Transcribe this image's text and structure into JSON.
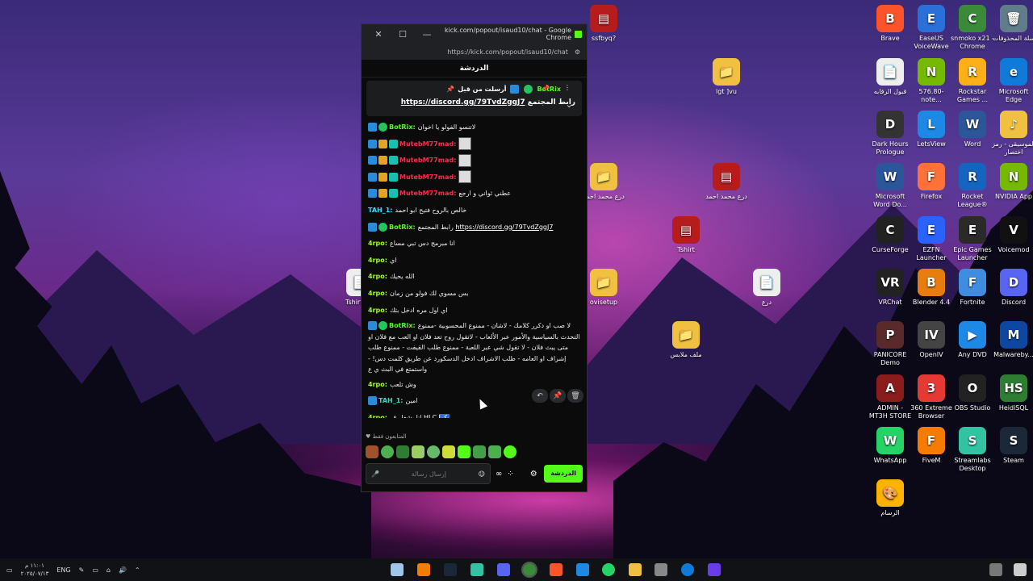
{
  "window": {
    "title": "kick.com/popout/isaud10/chat - Google Chrome",
    "url": "https://kick.com/popout/isaud10/chat",
    "chat_title": "الدردشة"
  },
  "pinned": {
    "pinned_by": "أرسلت من قبل",
    "bot": "BotRix",
    "label": "رابط المجتمع",
    "link": "https://discord.gg/79TvdZggJ7"
  },
  "messages": [
    {
      "user": "BotRix:",
      "color": "green",
      "text": "لاتنسو الفولو يا اخوان"
    },
    {
      "user": "MutebM77mad:",
      "color": "red",
      "text": ""
    },
    {
      "user": "MutebM77mad:",
      "color": "red",
      "text": ""
    },
    {
      "user": "MutebM77mad:",
      "color": "red",
      "text": ""
    },
    {
      "user": "MutebM77mad:",
      "color": "red",
      "text": "عطني ثواني و ارجع"
    },
    {
      "user": "TAH_1:",
      "color": "cyan",
      "text": "خالص بالروح فتيح ابو احمد"
    },
    {
      "user": "BotRix:",
      "color": "green",
      "text": "رابط المجتمع",
      "link": "https://discord.gg/79TvdZggJ7"
    },
    {
      "user": "4rpo:",
      "color": "lime",
      "text": "انا مبرمج دس تبي مساع"
    },
    {
      "user": "4rpo:",
      "color": "lime",
      "text": "اي"
    },
    {
      "user": "4rpo:",
      "color": "lime",
      "text": "الله يحيك"
    },
    {
      "user": "4rpo:",
      "color": "lime",
      "text": "بس مسوي لك فولو من زمان"
    },
    {
      "user": "4rpo:",
      "color": "lime",
      "text": "اي اول مره ادخل بثك"
    },
    {
      "user": "BotRix:",
      "color": "green",
      "text": "لا صب او دكرر كلامك - لاشان - ممنوع المحسوبية -ممنوع التحدث بالسياسية والأمور عبر الألعاب - لاتقول روح تعد فلان او العب مع فلان او متى يبث فلان - لا تقول شي عبر اللعبة - ممنوع طلب القيفت - ممنوع طلب إشراف او العامه - طلب الاشراف ادخل الدسكورد عن طريق كلمت دس! - واستمتع في البث ي ع"
    },
    {
      "user": "4rpo:",
      "color": "lime",
      "text": "وش تلعب"
    },
    {
      "user": "TAH_1:",
      "color": "teal",
      "text": "امين"
    },
    {
      "user": "4rpo:",
      "color": "lime",
      "text": "انا بشغل ف HLC",
      "highlight": "بكرا"
    }
  ],
  "emote_bar_label": "المتابعون فقط",
  "composer": {
    "placeholder": "إرسال رسالة",
    "send_label": "الدردشة"
  },
  "desktop_icons_right": [
    {
      "label": "Brave",
      "color": "#fb542b",
      "glyph": "B"
    },
    {
      "label": "EaseUS VoiceWave",
      "color": "#2b6fd8",
      "glyph": "E"
    },
    {
      "label": "snmoko x21 - Chrome",
      "color": "#3a8a3a",
      "glyph": "C"
    },
    {
      "label": "سلة المحذوفات",
      "color": "#607d8b",
      "glyph": "🗑"
    },
    {
      "label": "قبول الرقابه",
      "color": "#eeeeee",
      "glyph": "📄"
    },
    {
      "label": "576.80-note...",
      "color": "#76b900",
      "glyph": "N"
    },
    {
      "label": "Rockstar Games ...",
      "color": "#fcaf17",
      "glyph": "R"
    },
    {
      "label": "Microsoft Edge",
      "color": "#0f7ad8",
      "glyph": "e"
    },
    {
      "label": "Dark Hours Prologue",
      "color": "#333333",
      "glyph": "D"
    },
    {
      "label": "LetsView",
      "color": "#1e88e5",
      "glyph": "L"
    },
    {
      "label": "Word",
      "color": "#2b579a",
      "glyph": "W"
    },
    {
      "label": "الموسيقى - رمز اختصار",
      "color": "#f0c040",
      "glyph": "♪"
    },
    {
      "label": "Microsoft Word Do...",
      "color": "#2b579a",
      "glyph": "W"
    },
    {
      "label": "Firefox",
      "color": "#ff7139",
      "glyph": "F"
    },
    {
      "label": "Rocket League®",
      "color": "#1565c0",
      "glyph": "R"
    },
    {
      "label": "NVIDIA App",
      "color": "#76b900",
      "glyph": "N"
    },
    {
      "label": "CurseForge",
      "color": "#222222",
      "glyph": "C"
    },
    {
      "label": "EZFN Launcher",
      "color": "#2962ff",
      "glyph": "E"
    },
    {
      "label": "Epic Games Launcher",
      "color": "#2a2a2a",
      "glyph": "E"
    },
    {
      "label": "Voicemod",
      "color": "#111111",
      "glyph": "V"
    },
    {
      "label": "VRChat",
      "color": "#222222",
      "glyph": "VR"
    },
    {
      "label": "Blender 4.4",
      "color": "#e87d0d",
      "glyph": "B"
    },
    {
      "label": "Fortnite",
      "color": "#3f8de0",
      "glyph": "F"
    },
    {
      "label": "Discord",
      "color": "#5865f2",
      "glyph": "D"
    },
    {
      "label": "PANICORE Demo",
      "color": "#5a2a2a",
      "glyph": "P"
    },
    {
      "label": "OpenIV",
      "color": "#444444",
      "glyph": "IV"
    },
    {
      "label": "Any DVD",
      "color": "#1e88e5",
      "glyph": "▶"
    },
    {
      "label": "Malwareby...",
      "color": "#0d47a1",
      "glyph": "M"
    },
    {
      "label": "ADMIN - MT3H STORE",
      "color": "#8a1c1c",
      "glyph": "A"
    },
    {
      "label": "360 Extreme Browser",
      "color": "#e53935",
      "glyph": "3"
    },
    {
      "label": "OBS Studio",
      "color": "#222222",
      "glyph": "O"
    },
    {
      "label": "HeidiSQL",
      "color": "#2e7d32",
      "glyph": "HS"
    },
    {
      "label": "WhatsApp",
      "color": "#25d366",
      "glyph": "W"
    },
    {
      "label": "FiveM",
      "color": "#f57c00",
      "glyph": "F"
    },
    {
      "label": "Streamlabs Desktop",
      "color": "#31c3a2",
      "glyph": "S"
    },
    {
      "label": "Steam",
      "color": "#1b2838",
      "glyph": "S"
    },
    {
      "label": "الرسام",
      "color": "#ffb300",
      "glyph": "🎨"
    }
  ],
  "desktop_icons_middle": [
    {
      "label": "ssfbyq?",
      "color": "#b71c1c",
      "glyph": "▤"
    },
    {
      "label": "lgt ]vu",
      "color": "#f0c040",
      "glyph": "📁"
    },
    {
      "label": "درع محمد احمد",
      "color": "#f0c040",
      "glyph": "📁"
    },
    {
      "label": "درع محمد احمد",
      "color": "#b71c1c",
      "glyph": "▤"
    },
    {
      "label": "Tshirt",
      "color": "#b71c1c",
      "glyph": "▤"
    },
    {
      "label": "ovisetup",
      "color": "#f0c040",
      "glyph": "📁"
    },
    {
      "label": "درع",
      "color": "#eeeeee",
      "glyph": "📄"
    },
    {
      "label": "ملف ملابس",
      "color": "#f0c040",
      "glyph": "📁"
    },
    {
      "label": "Tshirt sto",
      "color": "#eeeeee",
      "glyph": "📄"
    }
  ],
  "tray": {
    "lang": "ENG",
    "time": "١١:٠١ م",
    "date": "٢٠٢٥/٠٧/١٣"
  }
}
